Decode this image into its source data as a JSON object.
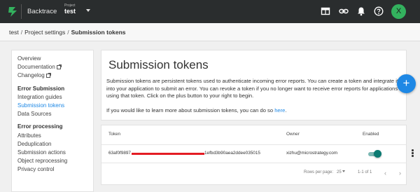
{
  "header": {
    "brand": "Backtrace",
    "project_label": "Project",
    "project_name": "test",
    "avatar_initial": "X",
    "icons": [
      "logo-icon",
      "dashboard-icon",
      "link-icon",
      "bell-icon",
      "help-icon"
    ]
  },
  "breadcrumb": {
    "items": [
      "test",
      "Project settings",
      "Submission tokens"
    ],
    "separator": "/"
  },
  "sidebar": {
    "top_items": [
      "Overview",
      "Documentation",
      "Changelog"
    ],
    "sections": [
      {
        "heading": "Error Submission",
        "items": [
          "Integration guides",
          "Submission tokens",
          "Data Sources"
        ]
      },
      {
        "heading": "Error processing",
        "items": [
          "Attributes",
          "Deduplication",
          "Submission actions",
          "Object reprocessing",
          "Privacy control"
        ]
      }
    ],
    "active_item": "Submission tokens"
  },
  "main": {
    "title": "Submission tokens",
    "description": "Submission tokens are persistent tokens used to authenticate incoming error reports. You can create a token and integrate it into your application to submit an error. You can revoke a token if you no longer want to receive error reports for applications using that token. Click on the plus button to your right to begin.",
    "learn_more_prefix": "If you would like to learn more about submission tokens, you can do so ",
    "learn_more_link": "here",
    "learn_more_suffix": ".",
    "add_button": "+"
  },
  "table": {
    "columns": [
      "Token",
      "Owner",
      "Enabled"
    ],
    "rows": [
      {
        "token_prefix": "63af0f9897",
        "token_suffix": "1efbd3b90aea2ddee035015",
        "owner": "xizhu@microstrategy.com",
        "enabled": true
      }
    ],
    "pagination": {
      "rows_per_page_label": "Rows per page:",
      "rows_per_page": "25",
      "range": "1-1 of 1"
    }
  },
  "colors": {
    "topbar": "#2a2d2e",
    "accent": "#1e88e5",
    "avatar": "#33b15e",
    "toggle_on": "#0b7a72",
    "redaction": "#e41c24"
  }
}
